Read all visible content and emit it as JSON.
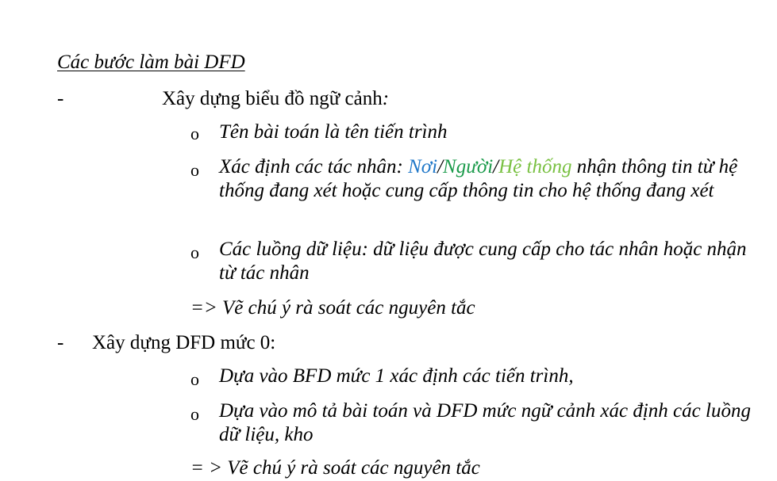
{
  "heading": "Các bước làm bài DFD",
  "sections": [
    {
      "dash": "-",
      "title": "Xây dựng biểu đồ ngữ cảnh",
      "title_suffix": ":",
      "items": [
        {
          "bullet": "o",
          "text": "Tên bài toán là tên tiến trình"
        },
        {
          "bullet": "o",
          "prefix": "Xác định các tác nhân: ",
          "colored": [
            "Nơi",
            "/",
            "Người",
            "/",
            "Hệ thống"
          ],
          "suffix": " nhận thông tin từ hệ thống đang xét hoặc cung cấp thông tin cho hệ thống đang xét"
        },
        {
          "bullet": "o",
          "text": "Các luồng dữ liệu: dữ liệu được cung cấp cho tác nhân hoặc nhận từ tác nhân"
        }
      ],
      "note": "=> Vẽ chú ý rà soát các nguyên tắc"
    },
    {
      "dash": "-",
      "title": "Xây dựng DFD mức 0:",
      "items": [
        {
          "bullet": "o",
          "text": "Dựa vào BFD mức 1 xác định các tiến trình,"
        },
        {
          "bullet": "o",
          "text": "Dựa vào mô tả bài toán và DFD mức ngữ cảnh xác định các luồng dữ liệu, kho"
        }
      ],
      "note": "= > Vẽ chú ý rà soát các nguyên tắc"
    }
  ],
  "colors": {
    "noi": "#1f77c8",
    "nguoi": "#1a9a4a",
    "he_thong": "#7ac143"
  }
}
